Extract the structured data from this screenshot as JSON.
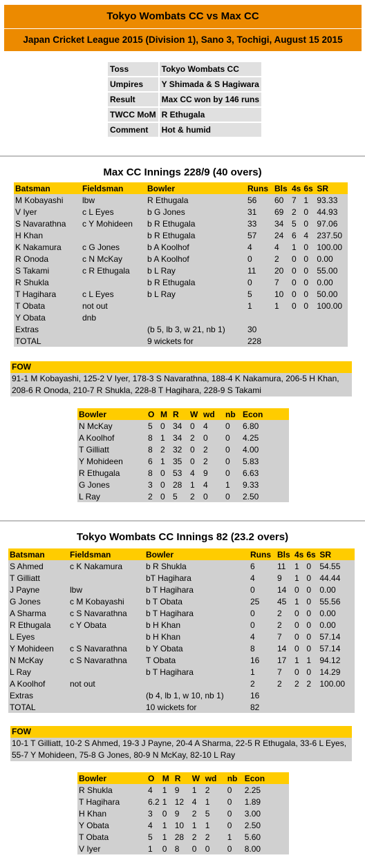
{
  "header": {
    "title": "Tokyo Wombats CC vs Max CC",
    "subtitle": "Japan Cricket League 2015 (Division 1), Sano 3, Tochigi, August 15 2015"
  },
  "match_info": [
    {
      "label": "Toss",
      "value": "Tokyo Wombats CC"
    },
    {
      "label": "Umpires",
      "value": "Y Shimada & S Hagiwara"
    },
    {
      "label": "Result",
      "value": "Max CC won by 146 runs"
    },
    {
      "label": "TWCC MoM",
      "value": "R Ethugala"
    },
    {
      "label": "Comment",
      "value": "Hot & humid"
    }
  ],
  "batting_headers": [
    "Batsman",
    "Fieldsman",
    "Bowler",
    "Runs",
    "Bls",
    "4s",
    "6s",
    "SR"
  ],
  "bowling_headers": [
    "Bowler",
    "O",
    "M",
    "R",
    "W",
    "wd",
    "nb",
    "Econ"
  ],
  "fow_label": "FOW",
  "innings": [
    {
      "title": "Max CC Innings 228/9 (40 overs)",
      "batting": [
        [
          "M Kobayashi",
          "lbw",
          "R Ethugala",
          "56",
          "60",
          "7",
          "1",
          "93.33"
        ],
        [
          "V Iyer",
          "c L Eyes",
          "b G Jones",
          "31",
          "69",
          "2",
          "0",
          "44.93"
        ],
        [
          "S Navarathna",
          "c Y Mohideen",
          "b R Ethugala",
          "33",
          "34",
          "5",
          "0",
          "97.06"
        ],
        [
          "H Khan",
          "",
          "b R Ethugala",
          "57",
          "24",
          "6",
          "4",
          "237.50"
        ],
        [
          "K Nakamura",
          "c G Jones",
          "b A Koolhof",
          "4",
          "4",
          "1",
          "0",
          "100.00"
        ],
        [
          "R Onoda",
          "c N McKay",
          "b A Koolhof",
          "0",
          "2",
          "0",
          "0",
          "0.00"
        ],
        [
          "S Takami",
          "c R Ethugala",
          "b L Ray",
          "11",
          "20",
          "0",
          "0",
          "55.00"
        ],
        [
          "R Shukla",
          "",
          "b R Ethugala",
          "0",
          "7",
          "0",
          "0",
          "0.00"
        ],
        [
          "T Hagihara",
          "c L Eyes",
          "b L Ray",
          "5",
          "10",
          "0",
          "0",
          "50.00"
        ],
        [
          "T Obata",
          "not out",
          "",
          "1",
          "1",
          "0",
          "0",
          "100.00"
        ],
        [
          "Y Obata",
          "dnb",
          "",
          "",
          "",
          "",
          "",
          ""
        ],
        [
          "Extras",
          "",
          "(b 5, lb 3, w 21, nb 1)",
          "30",
          "",
          "",
          "",
          ""
        ],
        [
          "TOTAL",
          "",
          "9 wickets for",
          "228",
          "",
          "",
          "",
          ""
        ]
      ],
      "fow": "91-1 M Kobayashi, 125-2 V Iyer, 178-3 S Navarathna, 188-4 K Nakamura, 206-5 H Khan, 208-6 R Onoda, 210-7 R Shukla, 228-8 T Hagihara, 228-9 S Takami",
      "bowling": [
        [
          "N McKay",
          "5",
          "0",
          "34",
          "0",
          "4",
          "0",
          "6.80"
        ],
        [
          "A Koolhof",
          "8",
          "1",
          "34",
          "2",
          "0",
          "0",
          "4.25"
        ],
        [
          "T Gilliatt",
          "8",
          "2",
          "32",
          "0",
          "2",
          "0",
          "4.00"
        ],
        [
          "Y Mohideen",
          "6",
          "1",
          "35",
          "0",
          "2",
          "0",
          "5.83"
        ],
        [
          "R Ethugala",
          "8",
          "0",
          "53",
          "4",
          "9",
          "0",
          "6.63"
        ],
        [
          "G Jones",
          "3",
          "0",
          "28",
          "1",
          "4",
          "1",
          "9.33"
        ],
        [
          "L Ray",
          "2",
          "0",
          "5",
          "2",
          "0",
          "0",
          "2.50"
        ]
      ]
    },
    {
      "title": "Tokyo Wombats CC Innings 82 (23.2 overs)",
      "batting": [
        [
          "S Ahmed",
          "c K Nakamura",
          "b R Shukla",
          "6",
          "11",
          "1",
          "0",
          "54.55"
        ],
        [
          "T Gilliatt",
          "",
          "bT Hagihara",
          "4",
          "9",
          "1",
          "0",
          "44.44"
        ],
        [
          "J Payne",
          "lbw",
          "b T Hagihara",
          "0",
          "14",
          "0",
          "0",
          "0.00"
        ],
        [
          "G Jones",
          "c M Kobayashi",
          "b T Obata",
          "25",
          "45",
          "1",
          "0",
          "55.56"
        ],
        [
          "A Sharma",
          "c S Navarathna",
          "b T Hagihara",
          "0",
          "2",
          "0",
          "0",
          "0.00"
        ],
        [
          "R Ethugala",
          "c Y Obata",
          "b H Khan",
          "0",
          "2",
          "0",
          "0",
          "0.00"
        ],
        [
          "L Eyes",
          "",
          "b H Khan",
          "4",
          "7",
          "0",
          "0",
          "57.14"
        ],
        [
          "Y Mohideen",
          "c S Navarathna",
          "b Y Obata",
          "8",
          "14",
          "0",
          "0",
          "57.14"
        ],
        [
          "N McKay",
          "c S Navarathna",
          "T Obata",
          "16",
          "17",
          "1",
          "1",
          "94.12"
        ],
        [
          "L Ray",
          "",
          "b T Hagihara",
          "1",
          "7",
          "0",
          "0",
          "14.29"
        ],
        [
          "A Koolhof",
          "not out",
          "",
          "2",
          "2",
          "2",
          "2",
          "100.00"
        ],
        [
          "Extras",
          "",
          "(b 4, lb 1, w 10, nb 1)",
          "16",
          "",
          "",
          "",
          ""
        ],
        [
          "TOTAL",
          "",
          "10 wickets for",
          "82",
          "",
          "",
          "",
          ""
        ]
      ],
      "fow": "10-1 T Gilliatt, 10-2 S Ahmed, 19-3 J Payne, 20-4 A Sharma, 22-5 R Ethugala, 33-6 L Eyes, 55-7 Y Mohideen, 75-8 G Jones, 80-9 N McKay, 82-10 L Ray",
      "bowling": [
        [
          "R Shukla",
          "4",
          "1",
          "9",
          "1",
          "2",
          "0",
          "2.25"
        ],
        [
          "T Hagihara",
          "6.2",
          "1",
          "12",
          "4",
          "1",
          "0",
          "1.89"
        ],
        [
          "H Khan",
          "3",
          "0",
          "9",
          "2",
          "5",
          "0",
          "3.00"
        ],
        [
          "Y Obata",
          "4",
          "1",
          "10",
          "1",
          "1",
          "0",
          "2.50"
        ],
        [
          "T Obata",
          "5",
          "1",
          "28",
          "2",
          "2",
          "1",
          "5.60"
        ],
        [
          "V Iyer",
          "1",
          "0",
          "8",
          "0",
          "0",
          "0",
          "8.00"
        ]
      ]
    }
  ]
}
